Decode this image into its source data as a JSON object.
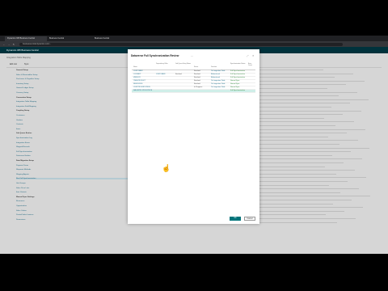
{
  "browser": {
    "tabs": [
      {
        "label": "Dynamics 365 Business Central"
      },
      {
        "label": "Business Central"
      },
      {
        "label": "Business Central"
      }
    ],
    "url": "businesscentral.dynamics.com/..."
  },
  "app": {
    "title": "Dynamics 365 Business Central"
  },
  "page": {
    "breadcrumb": "Integration Table Mapping",
    "commands": [
      "Edit List",
      "Sync"
    ]
  },
  "left_tree": [
    {
      "text": "General Setup",
      "kind": "h"
    },
    {
      "text": "Sales & Receivables Setup",
      "kind": "i"
    },
    {
      "text": "Purchases & Payables Setup",
      "kind": "i"
    },
    {
      "text": "Inventory Setup",
      "kind": "i"
    },
    {
      "text": "General Ledger Setup",
      "kind": "i"
    },
    {
      "text": "Currency Setup",
      "kind": "i"
    },
    {
      "text": "Connection Setup",
      "kind": "h"
    },
    {
      "text": "Integration Table Mapping",
      "kind": "i"
    },
    {
      "text": "Integration Field Mapping",
      "kind": "i"
    },
    {
      "text": "Coupling Setup",
      "kind": "h"
    },
    {
      "text": "Customers",
      "kind": "i"
    },
    {
      "text": "Vendors",
      "kind": "i"
    },
    {
      "text": "Contacts",
      "kind": "i"
    },
    {
      "text": "Items",
      "kind": "i"
    },
    {
      "text": "Job Queue Entries",
      "kind": "h"
    },
    {
      "text": "Synchronization Log",
      "kind": "i"
    },
    {
      "text": "Integration Errors",
      "kind": "i"
    },
    {
      "text": "Skipped Records",
      "kind": "i"
    },
    {
      "text": "Full Synchronization",
      "kind": "i"
    },
    {
      "text": "Dataverse Entities",
      "kind": "i"
    },
    {
      "text": "Data Migration Setup",
      "kind": "h"
    },
    {
      "text": "Payment Terms",
      "kind": "i"
    },
    {
      "text": "Shipment Methods",
      "kind": "i"
    },
    {
      "text": "Shipping Agents",
      "kind": "i"
    },
    {
      "text": "Run Full Synchronization",
      "kind": "sel"
    },
    {
      "text": "Unit Groups",
      "kind": "i"
    },
    {
      "text": "Sales Price Lists",
      "kind": "i"
    },
    {
      "text": "Item Variants",
      "kind": "i"
    },
    {
      "text": "Manual Sync Settings",
      "kind": "h"
    },
    {
      "text": "Resources",
      "kind": "i"
    },
    {
      "text": "Opportunities",
      "kind": "i"
    },
    {
      "text": "Sales Orders",
      "kind": "i"
    },
    {
      "text": "Posted Sales Invoices",
      "kind": "i"
    },
    {
      "text": "Dimensions",
      "kind": "i"
    }
  ],
  "right_desc_count": 42,
  "dialog": {
    "title": "Dataverse Full Synchronization Review",
    "columns": [
      "Name",
      "Dependency Filter",
      "Job Queue Entry Status",
      "Status",
      "Direction",
      "Synchronization Status",
      "Error Count"
    ],
    "rows": [
      {
        "name": "CUSTOMER",
        "dep": "",
        "jq": "",
        "status": "Finished",
        "dir": "To Integration Table",
        "sync": "Full Synchronization",
        "sel": false
      },
      {
        "name": "CONTACT",
        "dep": "CUSTOMER",
        "jq": "Finished",
        "status": "Finished",
        "dir": "Bidirectional",
        "sync": "Full Synchronization",
        "sel": false
      },
      {
        "name": "VENDOR",
        "dep": "",
        "jq": "",
        "status": "Finished",
        "dir": "Bidirectional",
        "sync": "Full Synchronization",
        "sel": false
      },
      {
        "name": "ITEM-PRODUCT",
        "dep": "",
        "jq": "",
        "status": "Finished",
        "dir": "To Integration Table",
        "sync": "Normal Sync",
        "sel": false
      },
      {
        "name": "RESOURCE",
        "dep": "",
        "jq": "",
        "status": "Finished",
        "dir": "To Integration Table",
        "sync": "Normal Sync",
        "sel": false
      },
      {
        "name": "CUSTPRCGRP-PRICE",
        "dep": "",
        "jq": "",
        "status": "In Progress",
        "dir": "To Integration Table",
        "sync": "Normal Sync",
        "sel": false
      },
      {
        "name": "SALESPRC-PRODPRICE",
        "dep": "",
        "jq": "",
        "status": "",
        "dir": "",
        "sync": "Full Synchronization",
        "sel": true
      }
    ],
    "ok_label": "OK",
    "cancel_label": "Cancel"
  }
}
